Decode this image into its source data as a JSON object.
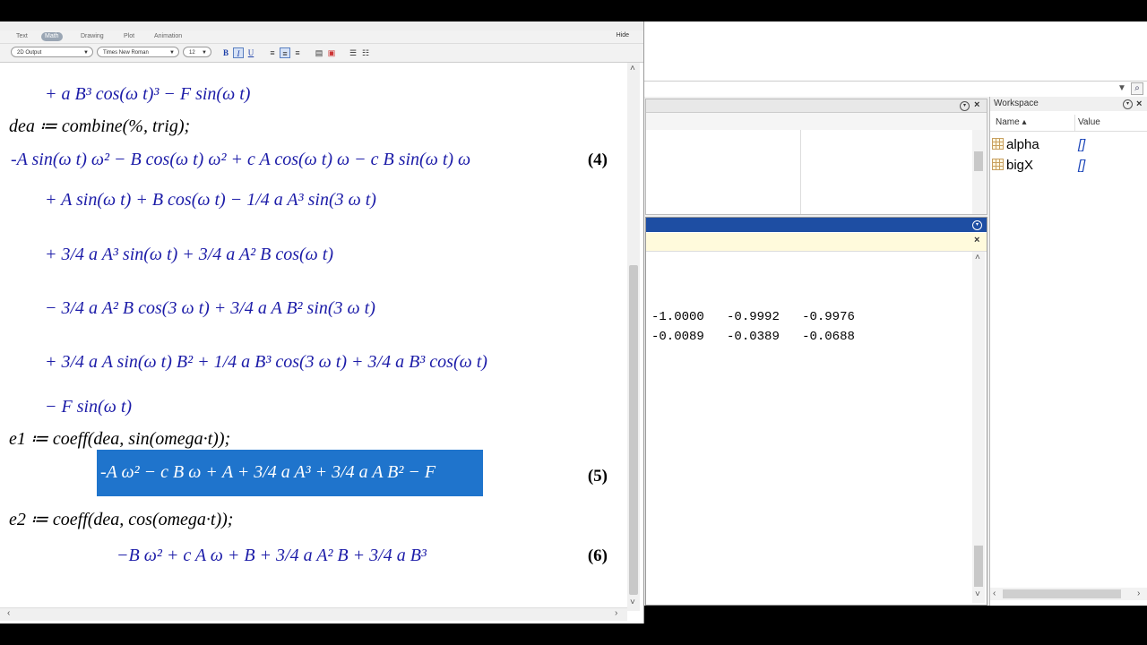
{
  "maple": {
    "context_tabs": [
      "Text",
      "Math",
      "Drawing",
      "Plot",
      "Animation"
    ],
    "hide_label": "Hide",
    "output_mode": "2D Output",
    "font_name": "Times New Roman",
    "font_size": "12",
    "bold": "B",
    "italic": "I",
    "underline": "U",
    "doc_lines": [
      "+ a B³ cos(ω t)³ − F sin(ω t)",
      "dea ≔ combine(%, trig);",
      "-A sin(ω t) ω² − B cos(ω t) ω² + c A cos(ω t) ω − c B sin(ω t) ω",
      "+ A sin(ω t) + B cos(ω t) − 1/4 a A³ sin(3 ω t)",
      "+ 3/4 a A³ sin(ω t) + 3/4 a A² B cos(ω t)",
      "− 3/4 a A² B cos(3 ω t) + 3/4 a A B² sin(3 ω t)",
      "+ 3/4 a A sin(ω t) B² + 1/4 a B³ cos(3 ω t) + 3/4 a B³ cos(ω t)",
      "− F sin(ω t)",
      "e1 ≔ coeff(dea, sin(omega·t));",
      "-A ω² − c B ω + A + 3/4 a A³ + 3/4 a A B² − F",
      "e2 ≔ coeff(dea, cos(omega·t));",
      "−B ω² + c A ω + B + 3/4 a A² B + 3/4 a B³"
    ],
    "equation_labels": [
      "(4)",
      "(5)",
      "(6)"
    ]
  },
  "matlab": {
    "command_rows": [
      [
        "-1.0000",
        "-0.9992",
        "-0.9976"
      ],
      [
        "-0.0089",
        "-0.0389",
        "-0.0688"
      ]
    ],
    "workspace": {
      "title": "Workspace",
      "col_name": "Name ▴",
      "col_value": "Value",
      "vars": [
        {
          "name": "alpha",
          "value": "[]"
        },
        {
          "name": "bigX",
          "value": "[]"
        }
      ]
    }
  }
}
